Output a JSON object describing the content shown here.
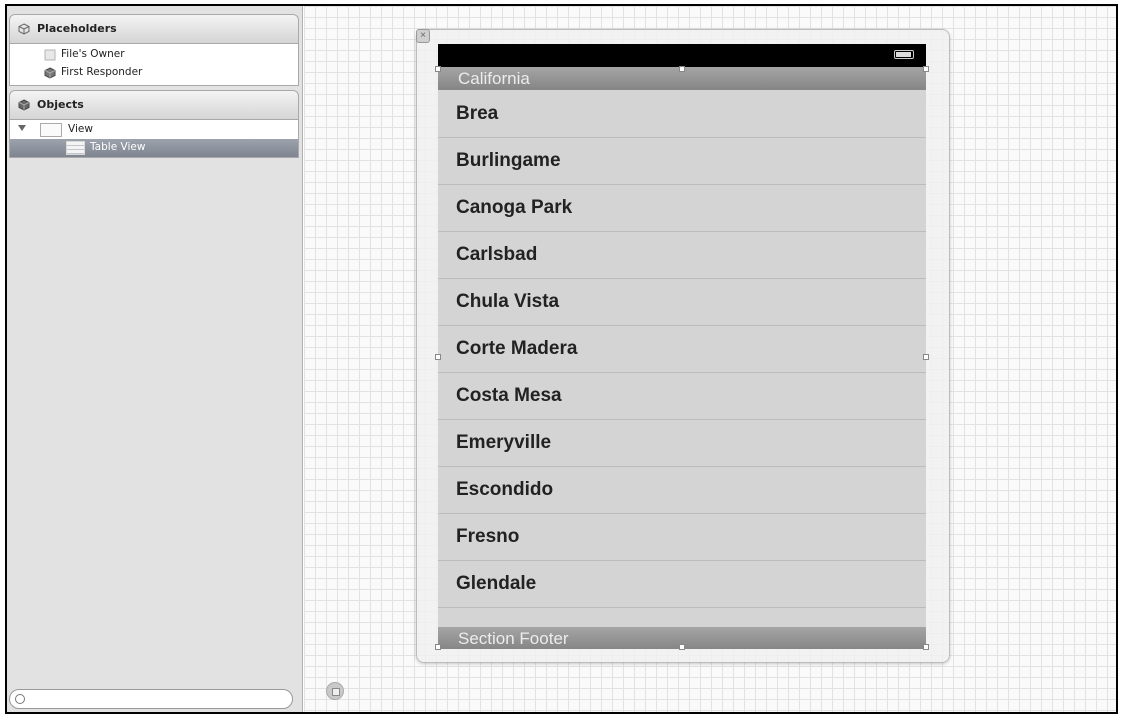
{
  "sidebar": {
    "placeholders_title": "Placeholders",
    "placeholders": [
      {
        "label": "File's Owner",
        "icon": "file-owner-icon"
      },
      {
        "label": "First Responder",
        "icon": "first-responder-icon"
      }
    ],
    "objects_title": "Objects",
    "tree": [
      {
        "label": "View",
        "selected": false
      },
      {
        "label": "Table View",
        "selected": true
      }
    ]
  },
  "canvas": {
    "section_header": "California",
    "cells": [
      "Brea",
      "Burlingame",
      "Canoga Park",
      "Carlsbad",
      "Chula Vista",
      "Corte Madera",
      "Costa Mesa",
      "Emeryville",
      "Escondido",
      "Fresno",
      "Glendale"
    ],
    "section_footer": "Section Footer"
  },
  "colors": {
    "selection": "#8a909a",
    "section_bar": "#969696",
    "cell_background": "#d4d4d4",
    "status_bar": "#000000"
  }
}
